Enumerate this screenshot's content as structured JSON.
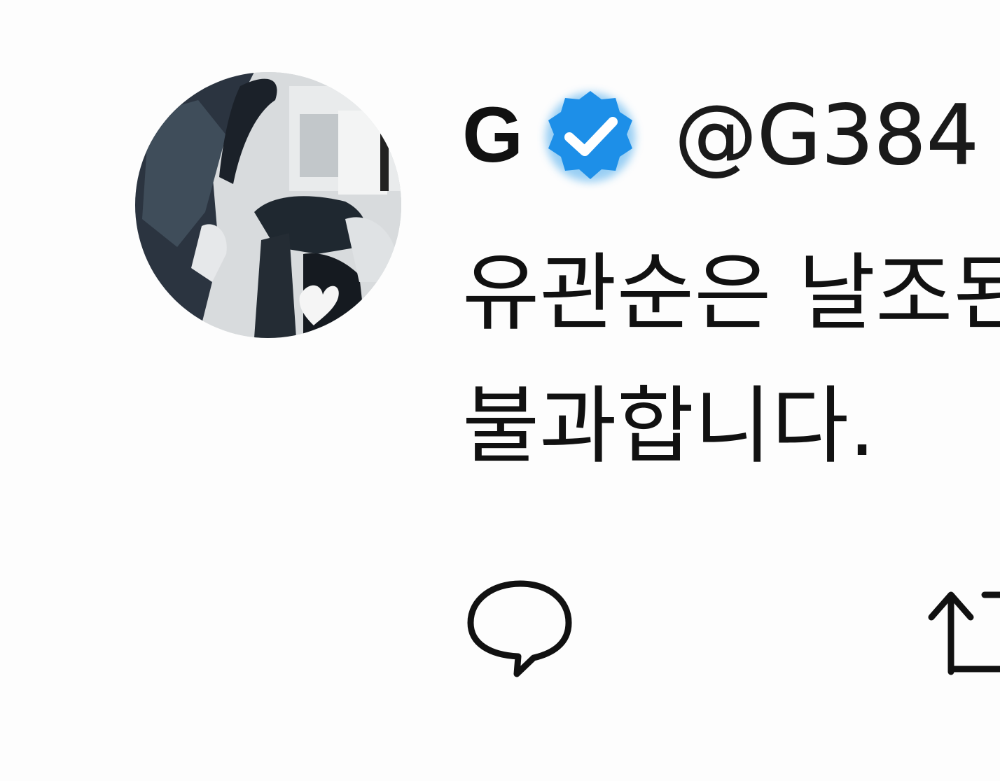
{
  "tweet": {
    "display_name": "G",
    "handle": "@G384",
    "verified": true,
    "body_lines": [
      "유관순은 날조된",
      "불과합니다."
    ]
  },
  "icons": {
    "avatar": "profile-photo",
    "badge": "verified-badge-icon",
    "reply": "reply-icon",
    "retweet": "retweet-icon"
  },
  "colors": {
    "badge": "#1d8fe8",
    "text": "#111111",
    "background": "#fdfdfd"
  }
}
